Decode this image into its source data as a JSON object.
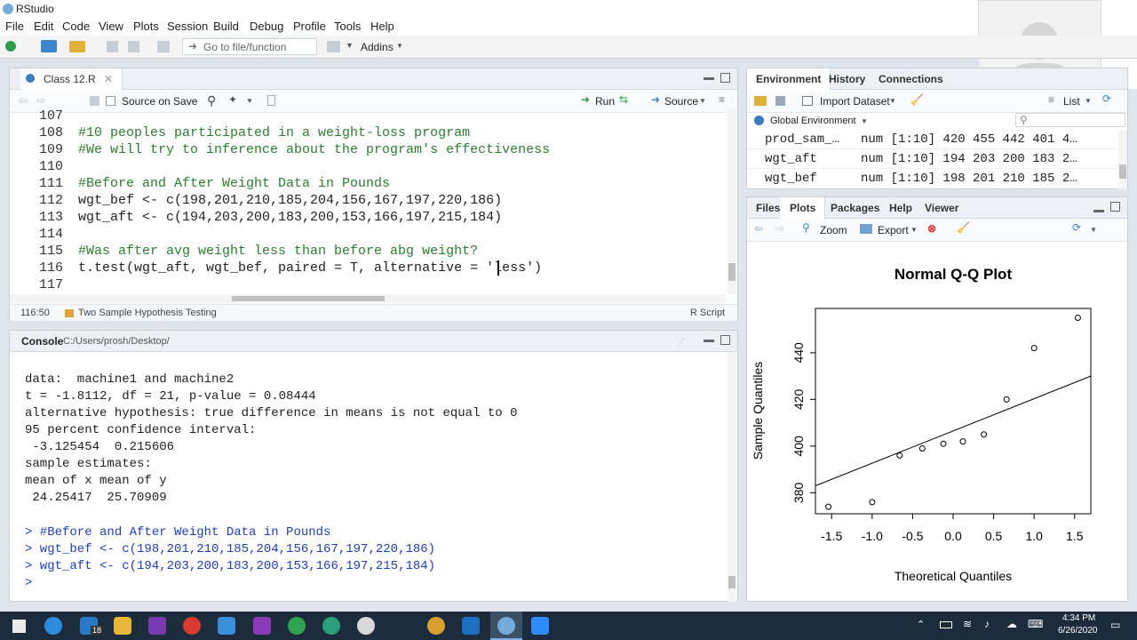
{
  "app": {
    "title": "RStudio"
  },
  "menu": [
    "File",
    "Edit",
    "Code",
    "View",
    "Plots",
    "Session",
    "Build",
    "Debug",
    "Profile",
    "Tools",
    "Help"
  ],
  "toolbar": {
    "goto_placeholder": "Go to file/function",
    "addins": "Addins"
  },
  "editor": {
    "tab": "Class 12.R",
    "source_on_save": "Source on Save",
    "run": "Run",
    "source": "Source",
    "lines": [
      {
        "n": "107",
        "t": ""
      },
      {
        "n": "108",
        "t": "#10 peoples participated in a weight-loss program"
      },
      {
        "n": "109",
        "t": "#We will try to inference about the program's effectiveness"
      },
      {
        "n": "110",
        "t": ""
      },
      {
        "n": "111",
        "t": "#Before and After Weight Data in Pounds"
      },
      {
        "n": "112",
        "t": "wgt_bef <- c(198,201,210,185,204,156,167,197,220,186)"
      },
      {
        "n": "113",
        "t": "wgt_aft <- c(194,203,200,183,200,153,166,197,215,184)"
      },
      {
        "n": "114",
        "t": ""
      },
      {
        "n": "115",
        "t": "#Was after avg weight less than before abg weight?"
      },
      {
        "n": "116",
        "t": "t.test(wgt_aft, wgt_bef, paired = T, alternative = 'less')"
      },
      {
        "n": "117",
        "t": ""
      }
    ],
    "status_pos": "116:50",
    "status_section": "Two Sample Hypothesis Testing",
    "status_type": "R Script"
  },
  "console": {
    "tab": "Console",
    "path": "C:/Users/prosh/Desktop/",
    "lines": [
      "data:  machine1 and machine2",
      "t = -1.8112, df = 21, p-value = 0.08444",
      "alternative hypothesis: true difference in means is not equal to 0",
      "95 percent confidence interval:",
      " -3.125454  0.215606",
      "sample estimates:",
      "mean of x mean of y",
      " 24.25417  25.70909",
      "",
      "> #Before and After Weight Data in Pounds",
      "> wgt_bef <- c(198,201,210,185,204,156,167,197,220,186)",
      "> wgt_aft <- c(194,203,200,183,200,153,166,197,215,184)",
      "> "
    ]
  },
  "env": {
    "tabs": [
      "Environment",
      "History",
      "Connections"
    ],
    "import": "Import Dataset",
    "list": "List",
    "scope": "Global Environment",
    "rows": [
      {
        "name": "prod_sam_…",
        "val": "num [1:10] 420 455 442 401 4…"
      },
      {
        "name": "wgt_aft",
        "val": "num [1:10] 194 203 200 183 2…"
      },
      {
        "name": "wgt_bef",
        "val": "num [1:10] 198 201 210 185 2…"
      }
    ]
  },
  "plots": {
    "tabs": [
      "Files",
      "Plots",
      "Packages",
      "Help",
      "Viewer"
    ],
    "zoom": "Zoom",
    "export": "Export"
  },
  "taskbar": {
    "time": "4:34 PM",
    "date": "6/26/2020",
    "badge": "18"
  },
  "chart_data": {
    "type": "scatter",
    "title": "Normal Q-Q Plot",
    "xlabel": "Theoretical Quantiles",
    "ylabel": "Sample Quantiles",
    "xlim": [
      -1.7,
      1.7
    ],
    "ylim": [
      371,
      459
    ],
    "xticks": [
      "-1.5",
      "-1.0",
      "-0.5",
      "0.0",
      "0.5",
      "1.0",
      "1.5"
    ],
    "yticks": [
      "380",
      "400",
      "420",
      "440"
    ],
    "x": [
      -1.54,
      -1.0,
      -0.66,
      -0.38,
      -0.12,
      0.12,
      0.38,
      0.66,
      1.0,
      1.54
    ],
    "y": [
      374,
      376,
      396,
      399,
      401,
      402,
      405,
      420,
      442,
      455
    ],
    "line": {
      "x": [
        -1.7,
        1.7
      ],
      "y": [
        383,
        430
      ]
    }
  }
}
